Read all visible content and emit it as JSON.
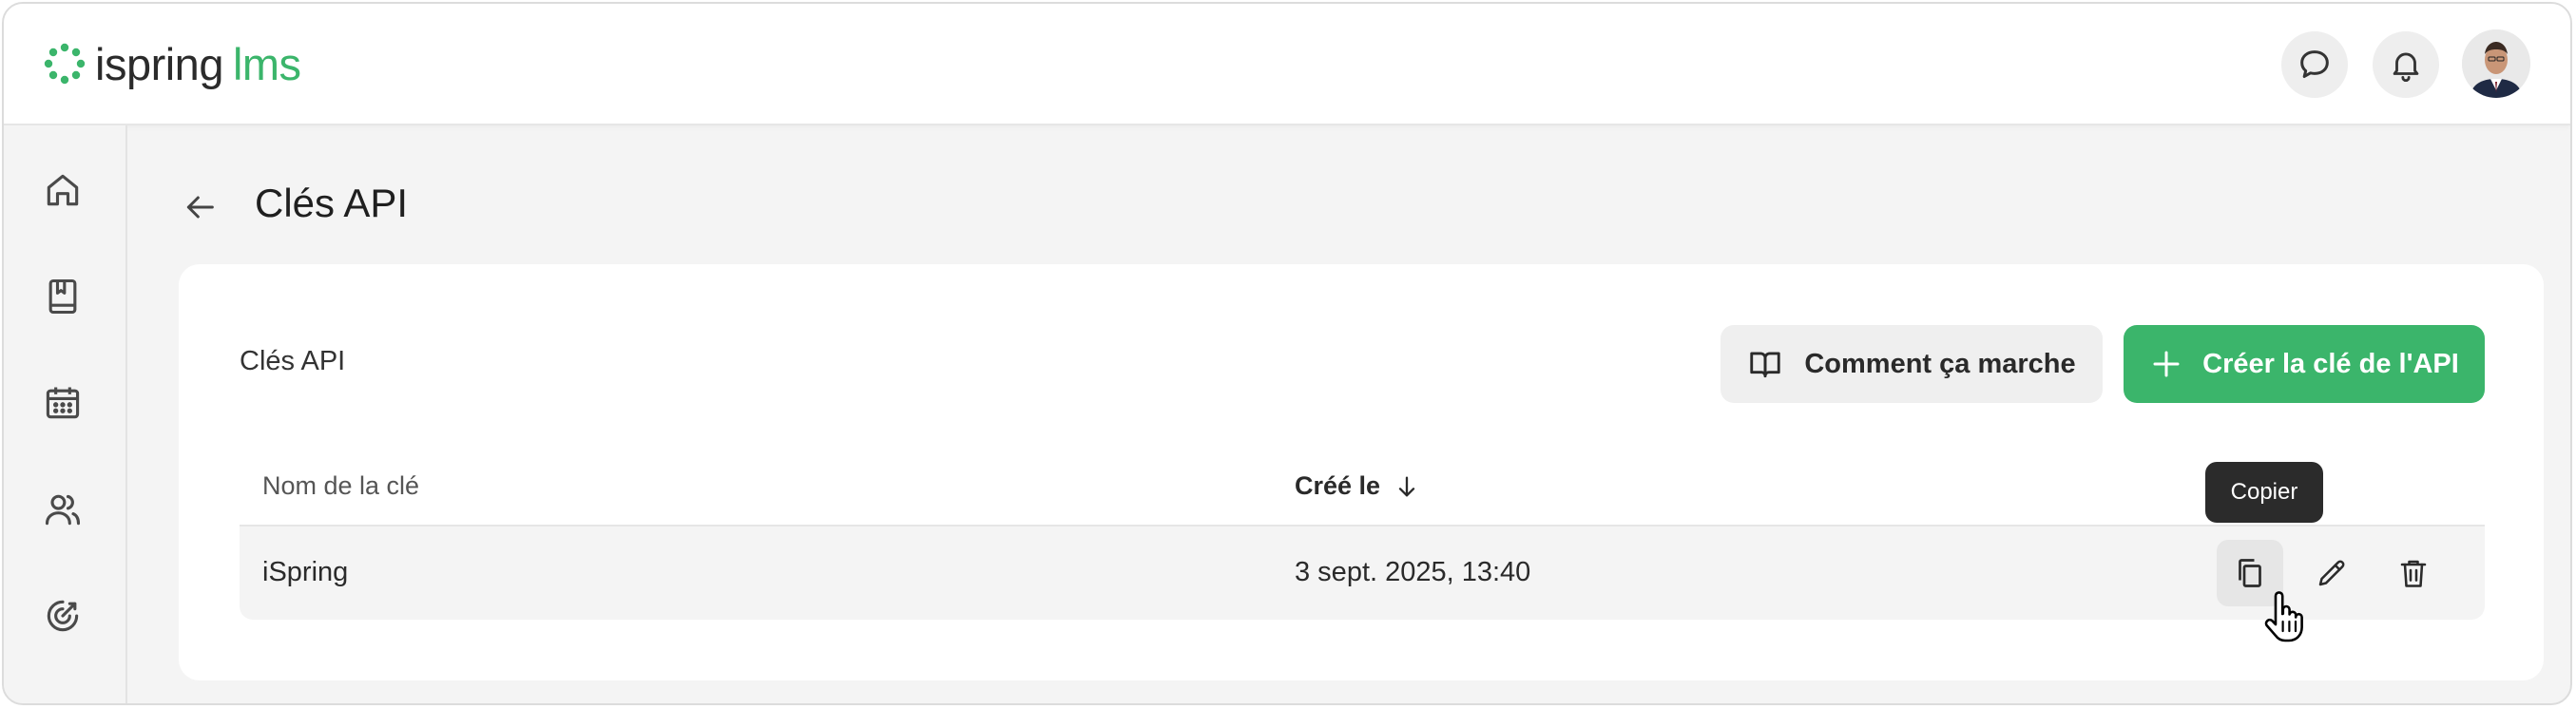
{
  "app": {
    "logo_word": "ispring",
    "logo_accent": "lms",
    "brand_color": "#3bb56b"
  },
  "header": {
    "icons": [
      "chat-icon",
      "bell-icon"
    ],
    "avatar": "user-avatar"
  },
  "sidebar": {
    "items": [
      {
        "icon": "home-icon"
      },
      {
        "icon": "book-icon"
      },
      {
        "icon": "calendar-icon"
      },
      {
        "icon": "users-icon"
      },
      {
        "icon": "target-icon"
      }
    ]
  },
  "page": {
    "title": "Clés API"
  },
  "card": {
    "title": "Clés API",
    "how_button": "Comment ça marche",
    "create_button": "Créer la clé de l'API",
    "columns": {
      "name": "Nom de la clé",
      "created": "Créé le"
    },
    "rows": [
      {
        "name": "iSpring",
        "created": "3 sept. 2025, 13:40"
      }
    ],
    "tooltip": "Copier"
  }
}
